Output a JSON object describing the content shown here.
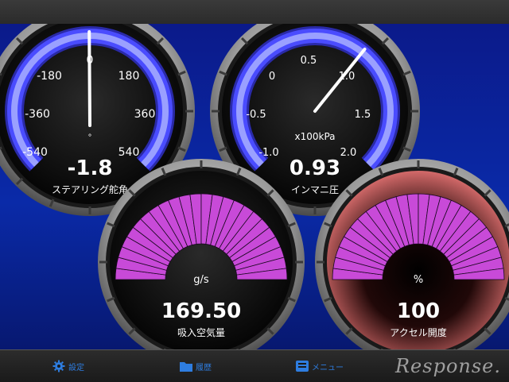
{
  "navigation": {
    "settings_label": "設定",
    "history_label": "履歴",
    "menu_label": "メニュー"
  },
  "watermark": "Response.",
  "gauges": {
    "steering": {
      "ticks": [
        "-540",
        "-360",
        "-180",
        "0",
        "180",
        "360",
        "540"
      ],
      "degree_symbol": "°",
      "value": "-1.8",
      "label": "ステアリング舵角",
      "needle_value": -1.8
    },
    "manifold": {
      "ticks": [
        "-1.0",
        "-0.5",
        "0",
        "0.5",
        "1.0",
        "1.5",
        "2.0"
      ],
      "unit": "x100kPa",
      "value": "0.93",
      "label": "インマニ圧",
      "needle_value": 0.93
    },
    "airflow": {
      "unit": "g/s",
      "value": "169.50",
      "label": "吸入空気量",
      "fill_fraction": 1.0
    },
    "accelerator": {
      "unit": "%",
      "value": "100",
      "label": "アクセル開度",
      "fill_fraction": 1.0
    }
  },
  "colors": {
    "arc_blue": "#4a4cff",
    "bar_purple": "#c84ad8",
    "alert_red": "#c84848"
  }
}
